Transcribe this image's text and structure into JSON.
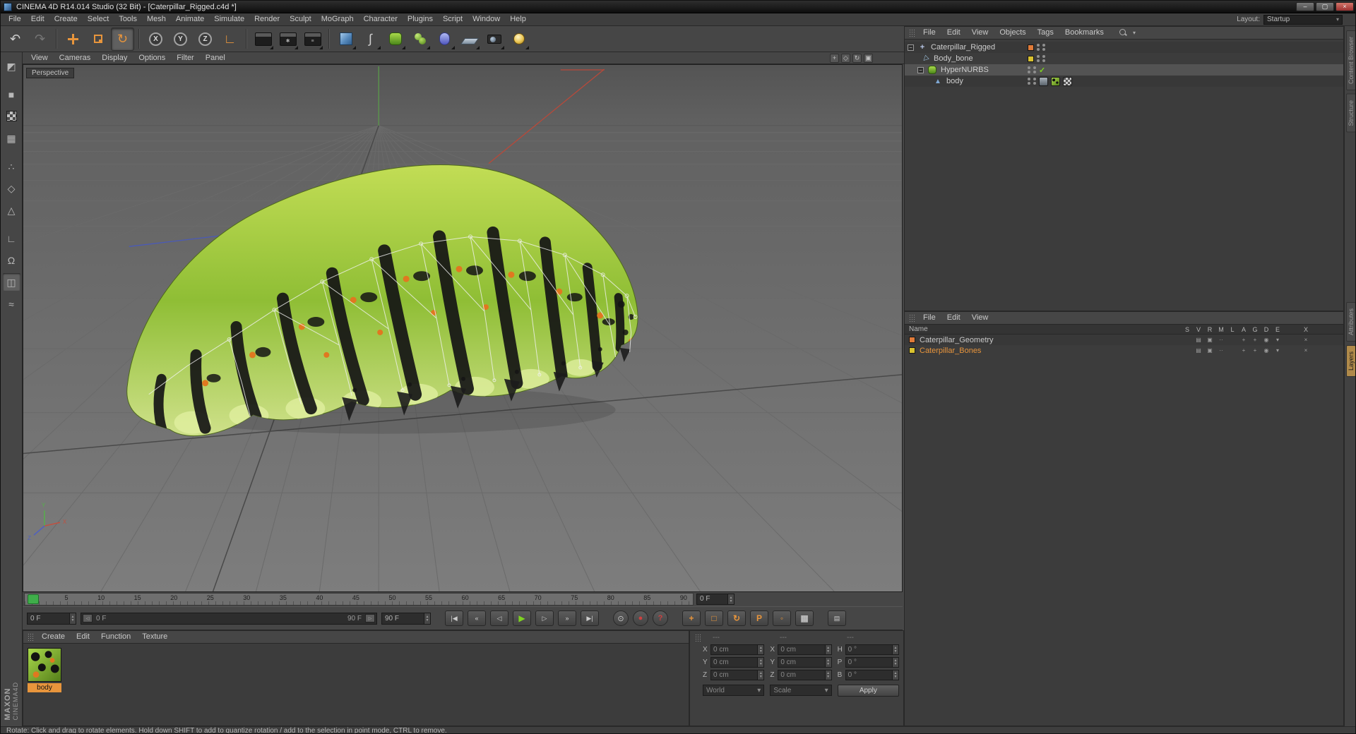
{
  "colors": {
    "accent": "#e8953c",
    "selection_orange": "#e8953c",
    "timeline_green": "#3fae4a",
    "check_green": "#7ed321",
    "layer_orange": "#e07b39",
    "layer_yellow": "#d9c22f"
  },
  "window": {
    "title": "CINEMA 4D R14.014 Studio (32 Bit) - [Caterpillar_Rigged.c4d *]",
    "minimize": "–",
    "maximize": "▢",
    "close": "×"
  },
  "menubar": {
    "items": [
      "File",
      "Edit",
      "Create",
      "Select",
      "Tools",
      "Mesh",
      "Animate",
      "Simulate",
      "Render",
      "Sculpt",
      "MoGraph",
      "Character",
      "Plugins",
      "Script",
      "Window",
      "Help"
    ],
    "layout_label": "Layout:",
    "layout_value": "Startup"
  },
  "icons": {
    "undo": "↶",
    "redo": "↷",
    "rotate": "↻",
    "axis": "∟",
    "snap": "Ω",
    "quantize": "≈",
    "make_editable": "◩",
    "model": "■",
    "workplane": "▦",
    "snap_settings": "◫",
    "points": "∴",
    "edges": "◇",
    "polygons": "△",
    "spline": "∫",
    "render_settings": "✱",
    "render_queue": "≡",
    "collapse": "−",
    "dropdown": "▾",
    "up": "▲",
    "down": "▼",
    "pan_view": "+",
    "zoom_view": "◇",
    "rotate_view": "↻",
    "toggle_view": "▣",
    "go_start": "|◀",
    "prev_key": "«",
    "prev_frame": "◁",
    "play": "▶",
    "next_frame": "▷",
    "next_key": "»",
    "go_end": "▶|",
    "record": "⊙",
    "autokey": "●",
    "help": "?",
    "rec_position": "+",
    "rec_scale": "□",
    "rec_rotation": "↻",
    "rec_parameter": "P",
    "rec_point": "◦",
    "keyframe_selection": "▦",
    "timeline_grid": "▤",
    "check": "✓",
    "lock_x": "X",
    "lock_y": "Y",
    "lock_z": "Z",
    "bone": "◁",
    "null_object": "+",
    "polygon_object": "▲"
  },
  "viewport": {
    "menu": [
      "View",
      "Cameras",
      "Display",
      "Options",
      "Filter",
      "Panel"
    ],
    "view_label": "Perspective",
    "axis_labels": {
      "x": "X",
      "y": "Y",
      "z": "Z"
    }
  },
  "object_manager": {
    "menu": [
      "File",
      "Edit",
      "View",
      "Objects",
      "Tags",
      "Bookmarks"
    ],
    "objects": [
      {
        "name": "Caterpillar_Rigged"
      },
      {
        "name": "Body_bone"
      },
      {
        "name": "HyperNURBS"
      },
      {
        "name": "body"
      }
    ]
  },
  "layer_manager": {
    "menu": [
      "File",
      "Edit",
      "View"
    ],
    "name_header": "Name",
    "columns": [
      "S",
      "V",
      "R",
      "M",
      "L",
      "A",
      "G",
      "D",
      "E",
      "X"
    ],
    "cell_glyphs": [
      "",
      "▤",
      "▣",
      "··",
      "",
      "+",
      "+",
      "◉",
      "▾",
      "×"
    ],
    "layers": [
      {
        "name": "Caterpillar_Geometry"
      },
      {
        "name": "Caterpillar_Bones"
      }
    ]
  },
  "right_tabs": {
    "top": [
      "Content Browser",
      "Structure"
    ],
    "bottom": [
      "Attributes",
      "Layers"
    ]
  },
  "timeline": {
    "ticks": [
      "0",
      "5",
      "10",
      "15",
      "20",
      "25",
      "30",
      "35",
      "40",
      "45",
      "50",
      "55",
      "60",
      "65",
      "70",
      "75",
      "80",
      "85",
      "90"
    ],
    "current_frame": "0 F"
  },
  "transport": {
    "start_frame": "0 F",
    "range_start": "0 F",
    "range_end": "90 F",
    "end_frame": "90 F"
  },
  "material_manager": {
    "menu": [
      "Create",
      "Edit",
      "Function",
      "Texture"
    ],
    "materials": [
      {
        "name": "body"
      }
    ]
  },
  "coordinates": {
    "section_headers": [
      "---",
      "---",
      "---"
    ],
    "fields": [
      {
        "label": "X",
        "value": "0 cm"
      },
      {
        "label": "X",
        "value": "0 cm"
      },
      {
        "label": "H",
        "value": "0 °"
      },
      {
        "label": "Y",
        "value": "0 cm"
      },
      {
        "label": "Y",
        "value": "0 cm"
      },
      {
        "label": "P",
        "value": "0 °"
      },
      {
        "label": "Z",
        "value": "0 cm"
      },
      {
        "label": "Z",
        "value": "0 cm"
      },
      {
        "label": "B",
        "value": "0 °"
      }
    ],
    "world": "World",
    "scale": "Scale",
    "apply": "Apply"
  },
  "status": {
    "text": "Rotate: Click and drag to rotate elements. Hold down SHIFT to add to quantize rotation / add to the selection in point mode, CTRL to remove."
  },
  "branding": {
    "maxon": "MAXON",
    "cinema": "CINEMA4D"
  }
}
